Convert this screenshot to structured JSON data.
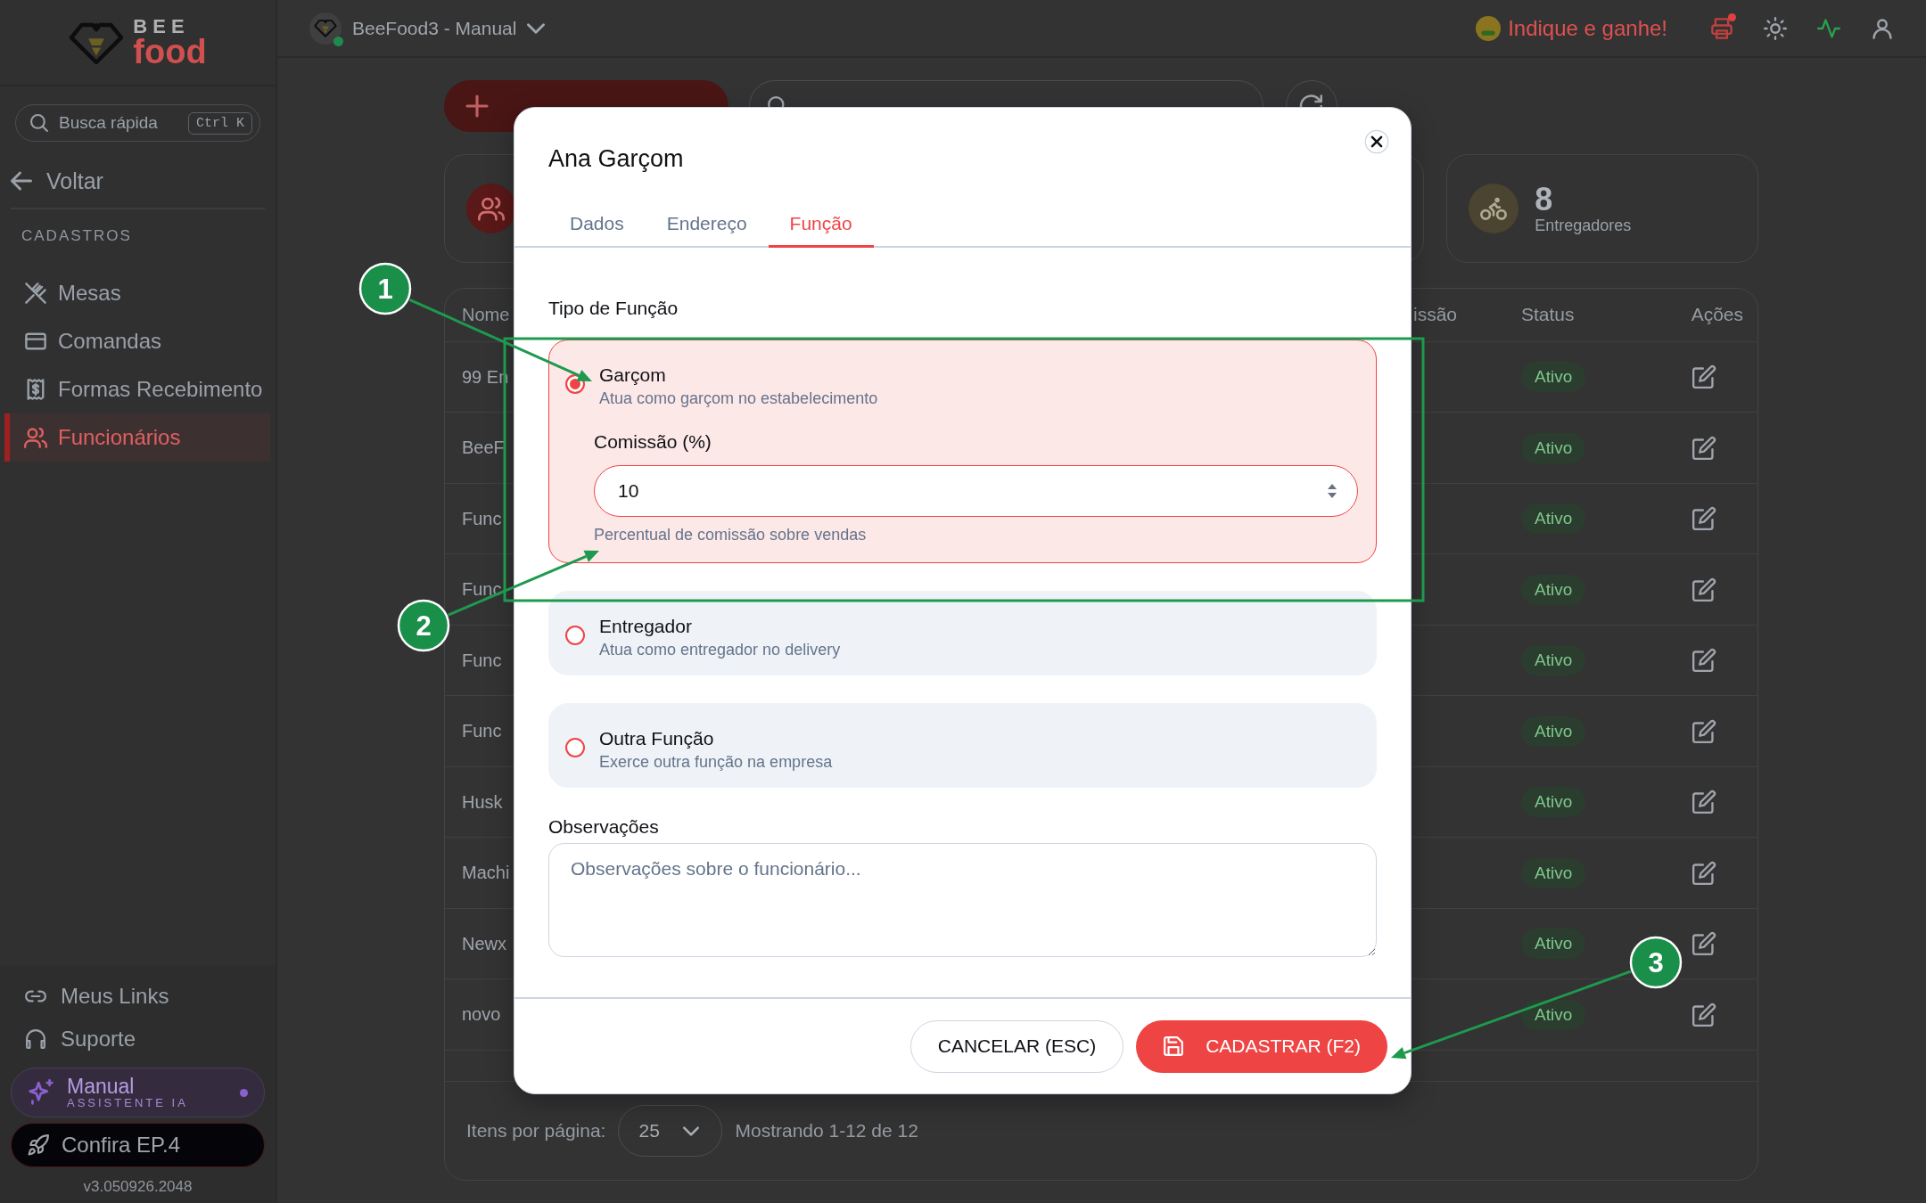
{
  "sidebar": {
    "logo": {
      "top": "BEE",
      "bottom": "food"
    },
    "search": {
      "placeholder": "Busca rápida",
      "shortcut": "Ctrl K"
    },
    "back": "Voltar",
    "section": "CADASTROS",
    "items": [
      {
        "label": "Mesas",
        "selected": false
      },
      {
        "label": "Comandas",
        "selected": false
      },
      {
        "label": "Formas Recebimento",
        "selected": false
      },
      {
        "label": "Funcionários",
        "selected": true
      }
    ],
    "links": [
      {
        "label": "Meus Links"
      },
      {
        "label": "Suporte"
      }
    ],
    "assistant": {
      "title": "Manual",
      "subtitle": "ASSISTENTE IA"
    },
    "promo": "Confira EP.4",
    "version": "v3.050926.2048"
  },
  "topbar": {
    "workspace": "BeeFood3 - Manual",
    "referral": "Indique e ganhe!"
  },
  "stats": [
    {
      "kind": "users"
    },
    {
      "kind": "covered"
    },
    {
      "kind": "bike",
      "value": "8",
      "label": "Entregadores"
    }
  ],
  "table": {
    "columns": [
      {
        "label": "Nome"
      },
      {
        "label": "issão"
      },
      {
        "label": "Status"
      },
      {
        "label": "Ações"
      }
    ],
    "rows": [
      {
        "name": "99 En",
        "status": "Ativo"
      },
      {
        "name": "BeeF",
        "status": "Ativo"
      },
      {
        "name": "Func",
        "status": "Ativo"
      },
      {
        "name": "Func",
        "status": "Ativo"
      },
      {
        "name": "Func",
        "status": "Ativo"
      },
      {
        "name": "Func",
        "status": "Ativo"
      },
      {
        "name": "Husk",
        "status": "Ativo"
      },
      {
        "name": "Machi",
        "status": "Ativo"
      },
      {
        "name": "Newx",
        "status": "Ativo"
      },
      {
        "name": "novo",
        "status": "Ativo"
      }
    ]
  },
  "pagination": {
    "label": "Itens por página:",
    "per_page": "25",
    "summary": "Mostrando 1-12 de 12"
  },
  "modal": {
    "title": "Ana Garçom",
    "tabs": [
      {
        "label": "Dados",
        "selected": false
      },
      {
        "label": "Endereço",
        "selected": false
      },
      {
        "label": "Função",
        "selected": true
      }
    ],
    "section_label": "Tipo de Função",
    "options": [
      {
        "title": "Garçom",
        "description": "Atua como garçom no estabelecimento",
        "selected": true,
        "commission": {
          "label": "Comissão (%)",
          "value": "10",
          "help": "Percentual de comissão sobre vendas"
        }
      },
      {
        "title": "Entregador",
        "description": "Atua como entregador no delivery",
        "selected": false
      },
      {
        "title": "Outra Função",
        "description": "Exerce outra função na empresa",
        "selected": false
      }
    ],
    "notes": {
      "label": "Observações",
      "placeholder": "Observações sobre o funcionário..."
    },
    "cancel_button": "CANCELAR (ESC)",
    "submit_button": "CADASTRAR (F2)"
  },
  "annotations": [
    {
      "label": "1"
    },
    {
      "label": "2"
    },
    {
      "label": "3"
    }
  ]
}
